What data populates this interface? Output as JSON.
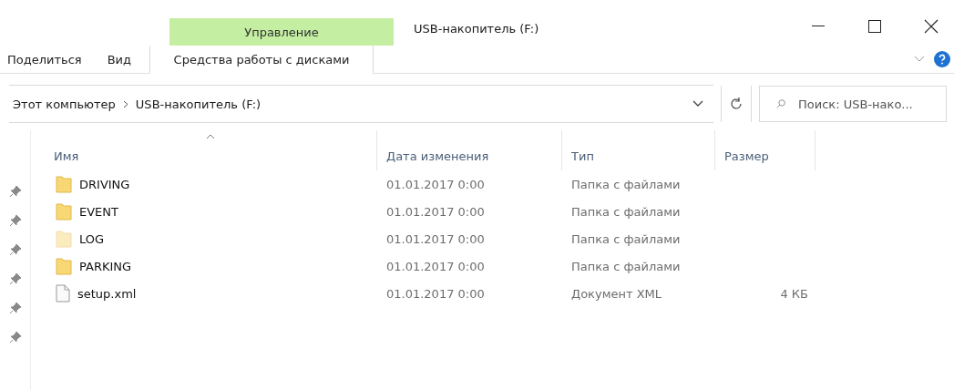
{
  "ribbon": {
    "context_group": "Управление",
    "window_title": "USB-накопитель (F:)",
    "tabs": [
      {
        "label": "Поделиться",
        "selected": false
      },
      {
        "label": "Вид",
        "selected": false
      },
      {
        "label": "Средства работы с дисками",
        "selected": true,
        "kind": "context"
      }
    ]
  },
  "address": {
    "path": [
      "Этот компьютер",
      "USB-накопитель (F:)"
    ],
    "search_placeholder": "Поиск: USB-нако..."
  },
  "columns": [
    "Имя",
    "Дата изменения",
    "Тип",
    "Размер"
  ],
  "rows": [
    {
      "kind": "folder",
      "hidden": false,
      "name": "DRIVING",
      "date": "01.01.2017 0:00",
      "type": "Папка с файлами"
    },
    {
      "kind": "folder",
      "hidden": false,
      "name": "EVENT",
      "date": "01.01.2017 0:00",
      "type": "Папка с файлами"
    },
    {
      "kind": "folder",
      "hidden": true,
      "name": "LOG",
      "date": "01.01.2017 0:00",
      "type": "Папка с файлами"
    },
    {
      "kind": "folder",
      "hidden": false,
      "name": "PARKING",
      "date": "01.01.2017 0:00",
      "type": "Папка с файлами"
    },
    {
      "kind": "file",
      "name": "setup.xml",
      "date": "01.01.2017 0:00",
      "type": "Документ XML",
      "size": "4 КБ"
    }
  ]
}
